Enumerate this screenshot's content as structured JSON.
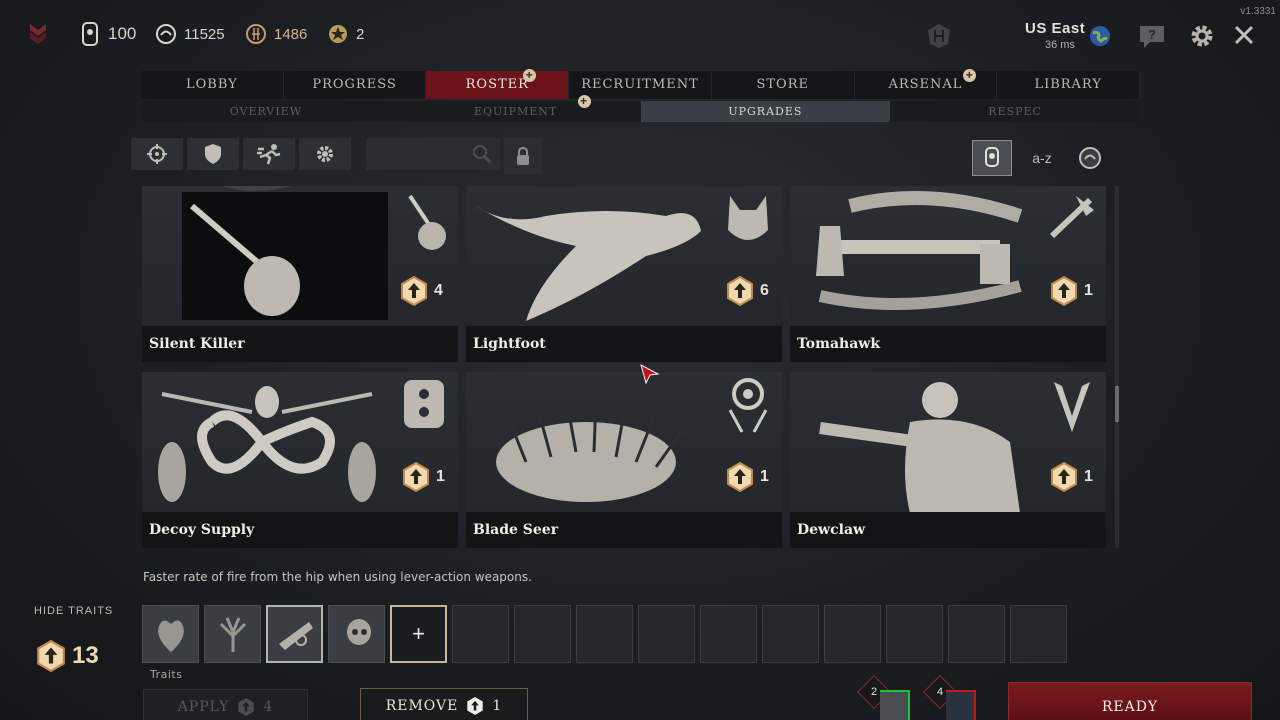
{
  "version": "v1.3331",
  "currencies": [
    {
      "icon": "dogtag-icon",
      "value": "100"
    },
    {
      "icon": "bloodbond-icon",
      "value": "11525"
    },
    {
      "icon": "hunt-dollar-icon",
      "value": "1486"
    },
    {
      "icon": "event-point-icon",
      "value": "2"
    }
  ],
  "server": {
    "name": "US East",
    "ping": "36 ms"
  },
  "nav_tabs": [
    "LOBBY",
    "PROGRESS",
    "ROSTER",
    "RECRUITMENT",
    "STORE",
    "ARSENAL",
    "LIBRARY"
  ],
  "active_tab": "ROSTER",
  "sub_tabs": [
    "OVERVIEW",
    "EQUIPMENT",
    "UPGRADES",
    "RESPEC"
  ],
  "active_sub_tab": "UPGRADES",
  "sort": {
    "alpha_label": "a-z"
  },
  "cards": [
    {
      "name": "Silent Killer",
      "cost": "4"
    },
    {
      "name": "Lightfoot",
      "cost": "6"
    },
    {
      "name": "Tomahawk",
      "cost": "1"
    },
    {
      "name": "Decoy Supply",
      "cost": "1"
    },
    {
      "name": "Blade Seer",
      "cost": "1"
    },
    {
      "name": "Dewclaw",
      "cost": "1"
    }
  ],
  "description": "Faster rate of fire from the hip when using lever-action weapons.",
  "hide_traits_label": "HIDE TRAITS",
  "upgrade_points": "13",
  "traits_label": "Traits",
  "apply": {
    "label": "APPLY",
    "cost": "4"
  },
  "remove": {
    "label": "REMOVE",
    "cost": "1"
  },
  "ready_label": "READY",
  "party": [
    {
      "count": "2"
    },
    {
      "count": "4"
    }
  ],
  "colors": {
    "accent_red": "#6b1419",
    "gold": "#f0d8b0"
  }
}
